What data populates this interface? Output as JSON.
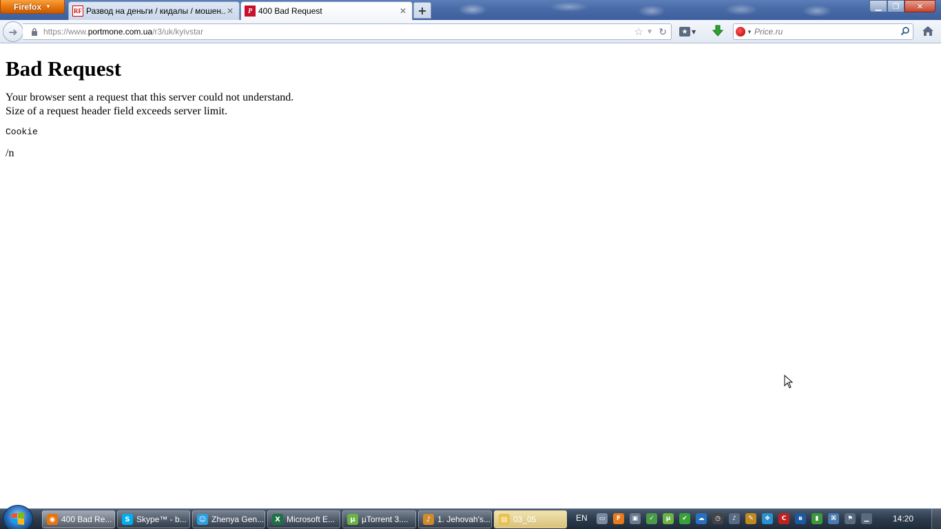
{
  "browser": {
    "menu_button_label": "Firefox",
    "tabs": [
      {
        "title": "Развод на деньги / кидалы / мошен...",
        "favicon": "rf-icon",
        "favicon_text": "RF",
        "active": false
      },
      {
        "title": "400 Bad Request",
        "favicon": "portmone-icon",
        "favicon_text": "P",
        "active": true
      }
    ],
    "new_tab_label": "+",
    "window_controls": {
      "minimize": "▁",
      "restore": "❐",
      "close": "✕"
    }
  },
  "navbar": {
    "url_prefix": "https://www.",
    "url_host": "portmone.com.ua",
    "url_path": "/r3/uk/kyivstar",
    "search_placeholder": "Price.ru",
    "search_engine": "yandex-icon"
  },
  "page": {
    "title": "Bad Request",
    "message": "Your browser sent a request that this server could not understand.",
    "detail": "Size of a request header field exceeds server limit.",
    "header_name": "Cookie",
    "path": "/n"
  },
  "taskbar": {
    "tasks": [
      {
        "label": "400 Bad Re...",
        "icon": "firefox-icon",
        "icon_color": "#e8740c",
        "icon_text": "◉",
        "active": true
      },
      {
        "label": "Skype™ - b...",
        "icon": "skype-icon",
        "icon_color": "#00aff0",
        "icon_text": "S",
        "active": false
      },
      {
        "label": "Zhenya Gen...",
        "icon": "chat-icon",
        "icon_color": "#2aa0e0",
        "icon_text": "☺",
        "active": false
      },
      {
        "label": "Microsoft E...",
        "icon": "excel-icon",
        "icon_color": "#1e7145",
        "icon_text": "X",
        "active": false
      },
      {
        "label": "µTorrent 3....",
        "icon": "utorrent-icon",
        "icon_color": "#6ab344",
        "icon_text": "µ",
        "active": false
      },
      {
        "label": "1. Jehovah's...",
        "icon": "media-icon",
        "icon_color": "#d08a2a",
        "icon_text": "♪",
        "active": false
      },
      {
        "label": "03_05",
        "icon": "folder-icon",
        "icon_color": "#e8c14a",
        "icon_text": "▤",
        "active": false
      }
    ],
    "language": "EN",
    "tray_icons": [
      {
        "name": "tray-monitor-icon",
        "color": "#7a8aa0",
        "text": "▭"
      },
      {
        "name": "tray-orange-icon",
        "color": "#e87a1a",
        "text": "F"
      },
      {
        "name": "tray-display-icon",
        "color": "#6a7a90",
        "text": "▣"
      },
      {
        "name": "tray-network-tools-icon",
        "color": "#4a9a4a",
        "text": "✓"
      },
      {
        "name": "tray-utorrent-icon",
        "color": "#6ab344",
        "text": "µ"
      },
      {
        "name": "tray-check-icon",
        "color": "#3aa03a",
        "text": "✔"
      },
      {
        "name": "tray-cloud-icon",
        "color": "#2a70c0",
        "text": "☁"
      },
      {
        "name": "tray-clock-icon",
        "color": "#444",
        "text": "◷"
      },
      {
        "name": "tray-volume-icon",
        "color": "#5a6a80",
        "text": "♪"
      },
      {
        "name": "tray-pen-icon",
        "color": "#c08a20",
        "text": "✎"
      },
      {
        "name": "tray-dropbox-icon",
        "color": "#2a90d0",
        "text": "❖"
      },
      {
        "name": "tray-red-icon",
        "color": "#c02020",
        "text": "C"
      },
      {
        "name": "tray-bluetooth-icon",
        "color": "#1a5aa0",
        "text": "ʙ"
      },
      {
        "name": "tray-signal-icon",
        "color": "#3a9a3a",
        "text": "▮"
      },
      {
        "name": "tray-network-icon",
        "color": "#4a7ab0",
        "text": "⌘"
      },
      {
        "name": "tray-flag-icon",
        "color": "#5a6a80",
        "text": "⚑"
      },
      {
        "name": "tray-wifi-icon",
        "color": "#5a6a80",
        "text": "▁"
      }
    ],
    "clock": "14:20"
  }
}
